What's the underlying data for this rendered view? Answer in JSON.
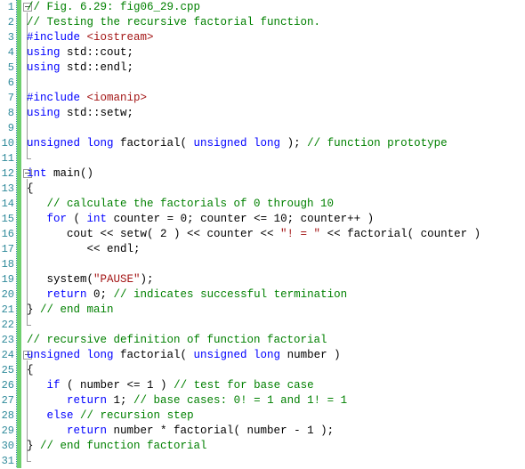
{
  "editor": {
    "title": "fig06_29.cpp",
    "colors": {
      "background": "#ffffff",
      "line_number": "#2f8a9b",
      "change_bar": "#6fcf6f",
      "keyword": "#0000ff",
      "comment": "#008000",
      "string": "#a31515",
      "text": "#000000",
      "fold_marker": "#9a9a9a"
    },
    "lines": [
      {
        "number": "1",
        "fold": "box",
        "tokens": [
          {
            "t": "// Fig. 6.29: fig06_29.cpp",
            "c": "cmt"
          }
        ]
      },
      {
        "number": "2",
        "fold": "line",
        "tokens": [
          {
            "t": "// Testing the recursive factorial function.",
            "c": "cmt"
          }
        ]
      },
      {
        "number": "3",
        "fold": "line",
        "tokens": [
          {
            "t": "#include ",
            "c": "pre"
          },
          {
            "t": "<iostream>",
            "c": "inc"
          }
        ]
      },
      {
        "number": "4",
        "fold": "line",
        "tokens": [
          {
            "t": "using",
            "c": "kw"
          },
          {
            "t": " std::cout;",
            "c": "txt"
          }
        ]
      },
      {
        "number": "5",
        "fold": "line",
        "tokens": [
          {
            "t": "using",
            "c": "kw"
          },
          {
            "t": " std::endl;",
            "c": "txt"
          }
        ]
      },
      {
        "number": "6",
        "fold": "line",
        "tokens": []
      },
      {
        "number": "7",
        "fold": "line",
        "tokens": [
          {
            "t": "#include ",
            "c": "pre"
          },
          {
            "t": "<iomanip>",
            "c": "inc"
          }
        ]
      },
      {
        "number": "8",
        "fold": "line",
        "tokens": [
          {
            "t": "using",
            "c": "kw"
          },
          {
            "t": " std::setw;",
            "c": "txt"
          }
        ]
      },
      {
        "number": "9",
        "fold": "line",
        "tokens": []
      },
      {
        "number": "10",
        "fold": "line",
        "tokens": [
          {
            "t": "unsigned long",
            "c": "kw"
          },
          {
            "t": " factorial( ",
            "c": "txt"
          },
          {
            "t": "unsigned long",
            "c": "kw"
          },
          {
            "t": " ); ",
            "c": "txt"
          },
          {
            "t": "// function prototype",
            "c": "cmt"
          }
        ]
      },
      {
        "number": "11",
        "fold": "end",
        "tokens": []
      },
      {
        "number": "12",
        "fold": "box",
        "tokens": [
          {
            "t": "int",
            "c": "kw"
          },
          {
            "t": " main()",
            "c": "txt"
          }
        ]
      },
      {
        "number": "13",
        "fold": "line",
        "tokens": [
          {
            "t": "{",
            "c": "txt"
          }
        ]
      },
      {
        "number": "14",
        "fold": "line",
        "tokens": [
          {
            "t": "   // calculate the factorials of 0 through 10",
            "c": "cmt"
          }
        ]
      },
      {
        "number": "15",
        "fold": "line",
        "tokens": [
          {
            "t": "   ",
            "c": "txt"
          },
          {
            "t": "for",
            "c": "kw"
          },
          {
            "t": " ( ",
            "c": "txt"
          },
          {
            "t": "int",
            "c": "kw"
          },
          {
            "t": " counter = 0; counter <= 10; counter++ )",
            "c": "txt"
          }
        ]
      },
      {
        "number": "16",
        "fold": "line",
        "tokens": [
          {
            "t": "      cout << setw( 2 ) << counter << ",
            "c": "txt"
          },
          {
            "t": "\"! = \"",
            "c": "str"
          },
          {
            "t": " << factorial( counter )",
            "c": "txt"
          }
        ]
      },
      {
        "number": "17",
        "fold": "line",
        "tokens": [
          {
            "t": "         << endl;",
            "c": "txt"
          }
        ]
      },
      {
        "number": "18",
        "fold": "line",
        "tokens": []
      },
      {
        "number": "19",
        "fold": "line",
        "tokens": [
          {
            "t": "   system(",
            "c": "txt"
          },
          {
            "t": "\"PAUSE\"",
            "c": "str"
          },
          {
            "t": ");",
            "c": "txt"
          }
        ]
      },
      {
        "number": "20",
        "fold": "line",
        "tokens": [
          {
            "t": "   ",
            "c": "txt"
          },
          {
            "t": "return",
            "c": "kw"
          },
          {
            "t": " 0; ",
            "c": "txt"
          },
          {
            "t": "// indicates successful termination",
            "c": "cmt"
          }
        ]
      },
      {
        "number": "21",
        "fold": "line",
        "tokens": [
          {
            "t": "} ",
            "c": "txt"
          },
          {
            "t": "// end main",
            "c": "cmt"
          }
        ]
      },
      {
        "number": "22",
        "fold": "end",
        "tokens": []
      },
      {
        "number": "23",
        "fold": "none",
        "tokens": [
          {
            "t": "// recursive definition of function factorial",
            "c": "cmt"
          }
        ]
      },
      {
        "number": "24",
        "fold": "box",
        "tokens": [
          {
            "t": "unsigned long",
            "c": "kw"
          },
          {
            "t": " factorial( ",
            "c": "txt"
          },
          {
            "t": "unsigned long",
            "c": "kw"
          },
          {
            "t": " number )",
            "c": "txt"
          }
        ]
      },
      {
        "number": "25",
        "fold": "line",
        "tokens": [
          {
            "t": "{",
            "c": "txt"
          }
        ]
      },
      {
        "number": "26",
        "fold": "line",
        "tokens": [
          {
            "t": "   ",
            "c": "txt"
          },
          {
            "t": "if",
            "c": "kw"
          },
          {
            "t": " ( number <= 1 ) ",
            "c": "txt"
          },
          {
            "t": "// test for base case",
            "c": "cmt"
          }
        ]
      },
      {
        "number": "27",
        "fold": "line",
        "tokens": [
          {
            "t": "      ",
            "c": "txt"
          },
          {
            "t": "return",
            "c": "kw"
          },
          {
            "t": " 1; ",
            "c": "txt"
          },
          {
            "t": "// base cases: 0! = 1 and 1! = 1",
            "c": "cmt"
          }
        ]
      },
      {
        "number": "28",
        "fold": "line",
        "tokens": [
          {
            "t": "   ",
            "c": "txt"
          },
          {
            "t": "else",
            "c": "kw"
          },
          {
            "t": " ",
            "c": "txt"
          },
          {
            "t": "// recursion step",
            "c": "cmt"
          }
        ]
      },
      {
        "number": "29",
        "fold": "line",
        "tokens": [
          {
            "t": "      ",
            "c": "txt"
          },
          {
            "t": "return",
            "c": "kw"
          },
          {
            "t": " number * factorial( number - 1 );",
            "c": "txt"
          }
        ]
      },
      {
        "number": "30",
        "fold": "line",
        "tokens": [
          {
            "t": "} ",
            "c": "txt"
          },
          {
            "t": "// end function factorial",
            "c": "cmt"
          }
        ]
      },
      {
        "number": "31",
        "fold": "end",
        "tokens": []
      }
    ]
  }
}
